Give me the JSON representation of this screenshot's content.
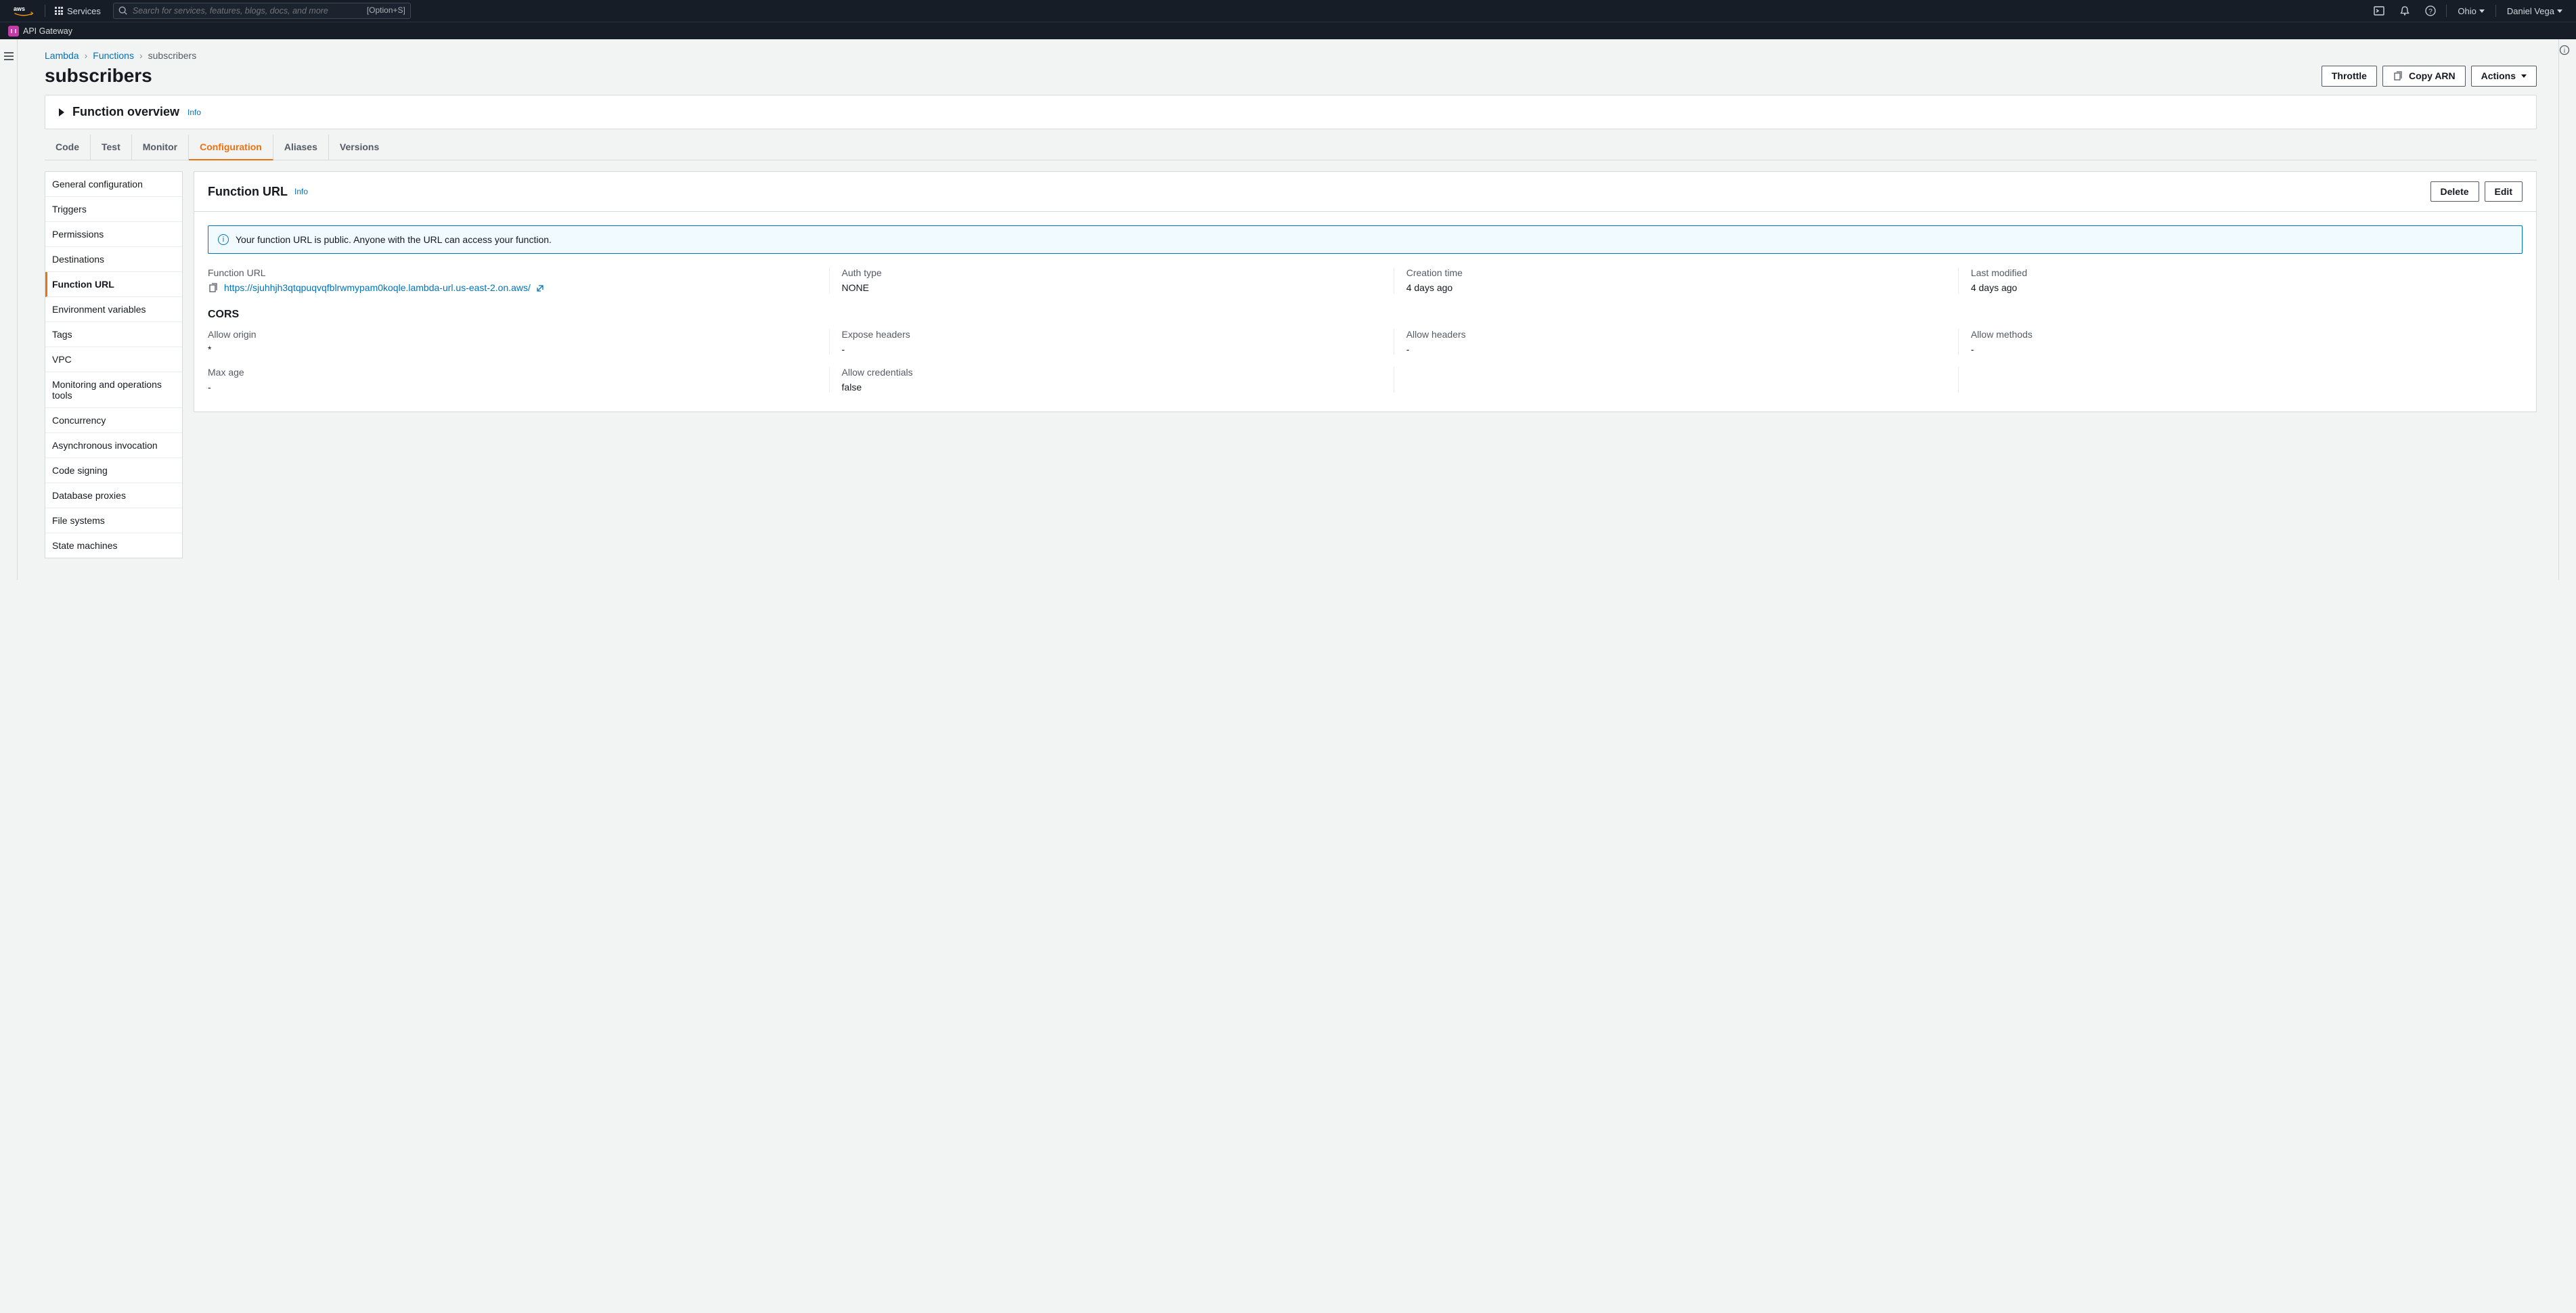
{
  "topnav": {
    "services_label": "Services",
    "search_placeholder": "Search for services, features, blogs, docs, and more",
    "kbd_hint": "[Option+S]",
    "region": "Ohio",
    "user_name": "Daniel Vega"
  },
  "subnav": {
    "recent_service": "API Gateway"
  },
  "breadcrumb": {
    "root": "Lambda",
    "lvl2": "Functions",
    "current": "subscribers"
  },
  "page": {
    "title": "subscribers",
    "actions": {
      "throttle": "Throttle",
      "copy_arn": "Copy ARN",
      "actions": "Actions"
    },
    "overview": {
      "title": "Function overview",
      "info": "Info"
    }
  },
  "tabs": [
    "Code",
    "Test",
    "Monitor",
    "Configuration",
    "Aliases",
    "Versions"
  ],
  "active_tab": "Configuration",
  "config_sidebar": [
    "General configuration",
    "Triggers",
    "Permissions",
    "Destinations",
    "Function URL",
    "Environment variables",
    "Tags",
    "VPC",
    "Monitoring and operations tools",
    "Concurrency",
    "Asynchronous invocation",
    "Code signing",
    "Database proxies",
    "File systems",
    "State machines"
  ],
  "config_active": "Function URL",
  "function_url": {
    "panel_title": "Function URL",
    "info": "Info",
    "actions": {
      "delete": "Delete",
      "edit": "Edit"
    },
    "alert": "Your function URL is public. Anyone with the URL can access your function.",
    "fields": {
      "url_label": "Function URL",
      "url_value": "https://sjuhhjh3qtqpuqvqfblrwmypam0koqle.lambda-url.us-east-2.on.aws/",
      "auth_label": "Auth type",
      "auth_value": "NONE",
      "creation_label": "Creation time",
      "creation_value": "4 days ago",
      "modified_label": "Last modified",
      "modified_value": "4 days ago"
    },
    "cors": {
      "title": "CORS",
      "allow_origin_label": "Allow origin",
      "allow_origin_value": "*",
      "expose_headers_label": "Expose headers",
      "expose_headers_value": "-",
      "allow_headers_label": "Allow headers",
      "allow_headers_value": "-",
      "allow_methods_label": "Allow methods",
      "allow_methods_value": "-",
      "max_age_label": "Max age",
      "max_age_value": "-",
      "allow_credentials_label": "Allow credentials",
      "allow_credentials_value": "false"
    }
  }
}
